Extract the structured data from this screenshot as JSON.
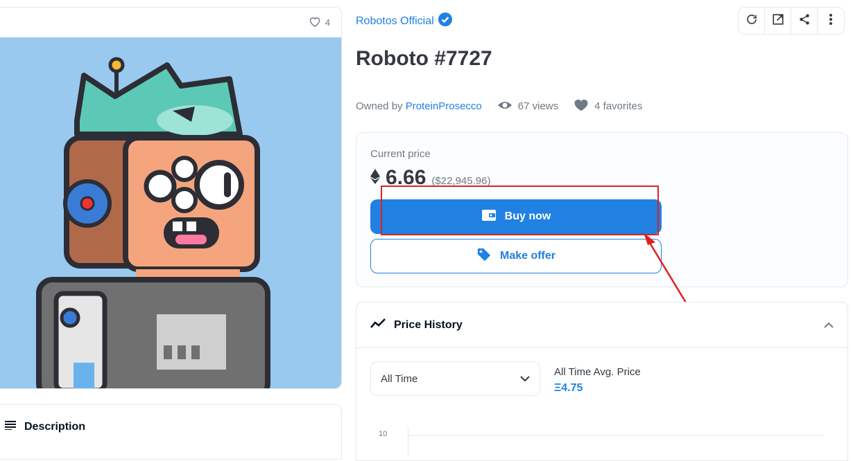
{
  "image_panel": {
    "favorites_count": "4",
    "art_description_icon": "roboto-nft-art"
  },
  "description": {
    "label": "Description"
  },
  "collection": {
    "name": "Robotos Official",
    "verified_icon": "verified-badge-icon"
  },
  "toolbar": {
    "icons": [
      "refresh-icon",
      "external-link-icon",
      "share-icon",
      "more-icon"
    ]
  },
  "asset": {
    "title": "Roboto #7727",
    "owned_by_label": "Owned by",
    "owner": "ProteinProsecco",
    "views": "67 views",
    "favorites": "4 favorites"
  },
  "price": {
    "label": "Current price",
    "eth": "6.66",
    "usd": "($22,945.96)",
    "buy_label": "Buy now",
    "offer_label": "Make offer"
  },
  "price_history": {
    "title": "Price History",
    "period": "All Time",
    "avg_label": "All Time Avg. Price",
    "avg_value": "Ξ4.75",
    "y_tick": "10"
  },
  "colors": {
    "accent": "#2081e2",
    "annotation": "#e02020",
    "art_background": "#99c9ef"
  }
}
